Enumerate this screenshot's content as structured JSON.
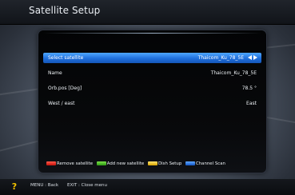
{
  "window": {
    "title": "Satellite Setup"
  },
  "settings": [
    {
      "label": "Select satellite",
      "value": "Thaicom_Ku_78_5E",
      "selected": true
    },
    {
      "label": "Name",
      "value": "Thaicom_Ku_78_5E"
    },
    {
      "label": "Orb.pos [Deg]",
      "value": "78.5 °"
    },
    {
      "label": "West / east",
      "value": "East"
    }
  ],
  "color_keys": [
    {
      "label": "Remove satellite",
      "color": "#e8201a"
    },
    {
      "label": "Add new satellite",
      "color": "#3fbf1c"
    },
    {
      "label": "Dish Setup",
      "color": "#f2c41b"
    },
    {
      "label": "Channel Scan",
      "color": "#1c6fe0"
    }
  ],
  "footer": {
    "menu_hint": "MENU : Back",
    "exit_hint": "EXIT : Close menu",
    "help_icon": "question-mark-icon"
  },
  "colors": {
    "selection": "#2f86f0",
    "title_text": "#e9edf2"
  }
}
